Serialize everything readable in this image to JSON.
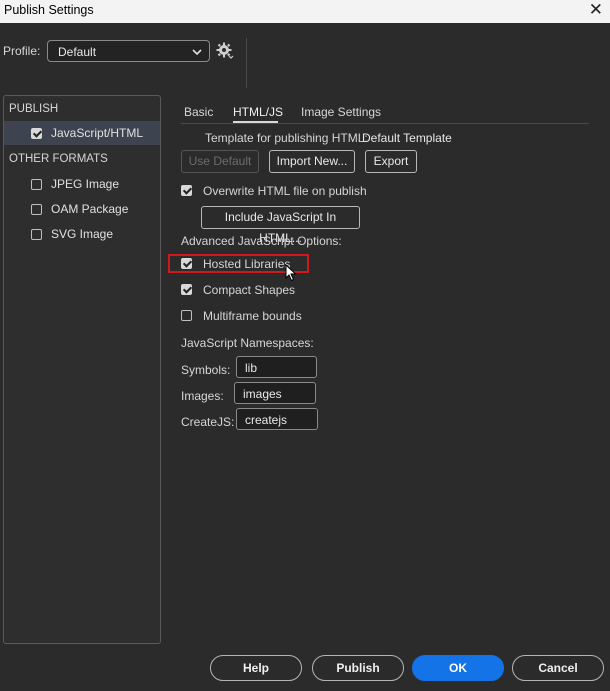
{
  "window": {
    "title": "Publish Settings",
    "close_glyph": "✕"
  },
  "profile": {
    "label": "Profile:",
    "value": "Default",
    "icon": "gear-icon"
  },
  "left_panel": {
    "publish_header": "PUBLISH",
    "publish_items": [
      {
        "label": "JavaScript/HTML",
        "checked": true,
        "selected": true
      }
    ],
    "other_header": "OTHER FORMATS",
    "other_items": [
      {
        "label": "JPEG Image",
        "checked": false
      },
      {
        "label": "OAM Package",
        "checked": false
      },
      {
        "label": "SVG Image",
        "checked": false
      }
    ]
  },
  "tabs": [
    {
      "label": "Basic"
    },
    {
      "label": "HTML/JS",
      "active": true
    },
    {
      "label": "Image Settings"
    }
  ],
  "html_js": {
    "template_label": "Template for publishing HTML:",
    "template_value": "Default Template",
    "use_default": "Use Default",
    "import_new": "Import New...",
    "export": "Export",
    "overwrite_label": "Overwrite HTML file on publish",
    "overwrite_checked": true,
    "include_js": "Include JavaScript In HTML...",
    "advanced_label": "Advanced JavaScript Options:",
    "hosted_libraries": "Hosted Libraries",
    "hosted_checked": true,
    "compact_shapes": "Compact Shapes",
    "compact_checked": true,
    "multiframe_bounds": "Multiframe bounds",
    "multiframe_checked": false,
    "namespaces_label": "JavaScript Namespaces:",
    "symbols_label": "Symbols:",
    "symbols_value": "lib",
    "images_label": "Images:",
    "images_value": "images",
    "createjs_label": "CreateJS:",
    "createjs_value": "createjs"
  },
  "footer": {
    "help": "Help",
    "publish": "Publish",
    "ok": "OK",
    "cancel": "Cancel"
  },
  "colors": {
    "accent": "#1473e6",
    "highlight": "#d0181f",
    "background": "#2b2b2b"
  }
}
